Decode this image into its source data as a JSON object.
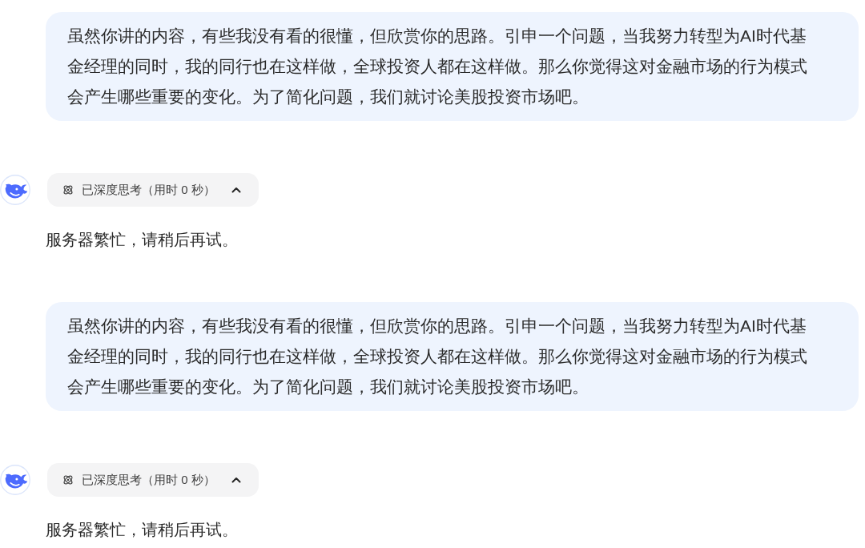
{
  "messages": [
    {
      "kind": "user",
      "text": "虽然你讲的内容，有些我没有看的很懂，但欣赏你的思路。引申一个问题，当我努力转型为AI时代基金经理的同时，我的同行也在这样做，全球投资人都在这样做。那么你觉得这对金融市场的行为模式会产生哪些重要的变化。为了简化问题，我们就讨论美股投资市场吧。"
    },
    {
      "kind": "assistant",
      "thinking": {
        "label": "已深度思考（用时 0 秒）",
        "expanded": true
      },
      "text": "服务器繁忙，请稍后再试。"
    },
    {
      "kind": "user",
      "text": "虽然你讲的内容，有些我没有看的很懂，但欣赏你的思路。引申一个问题，当我努力转型为AI时代基金经理的同时，我的同行也在这样做，全球投资人都在这样做。那么你觉得这对金融市场的行为模式会产生哪些重要的变化。为了简化问题，我们就讨论美股投资市场吧。"
    },
    {
      "kind": "assistant",
      "thinking": {
        "label": "已深度思考（用时 0 秒）",
        "expanded": true
      },
      "text": "服务器繁忙，请稍后再试。"
    }
  ]
}
